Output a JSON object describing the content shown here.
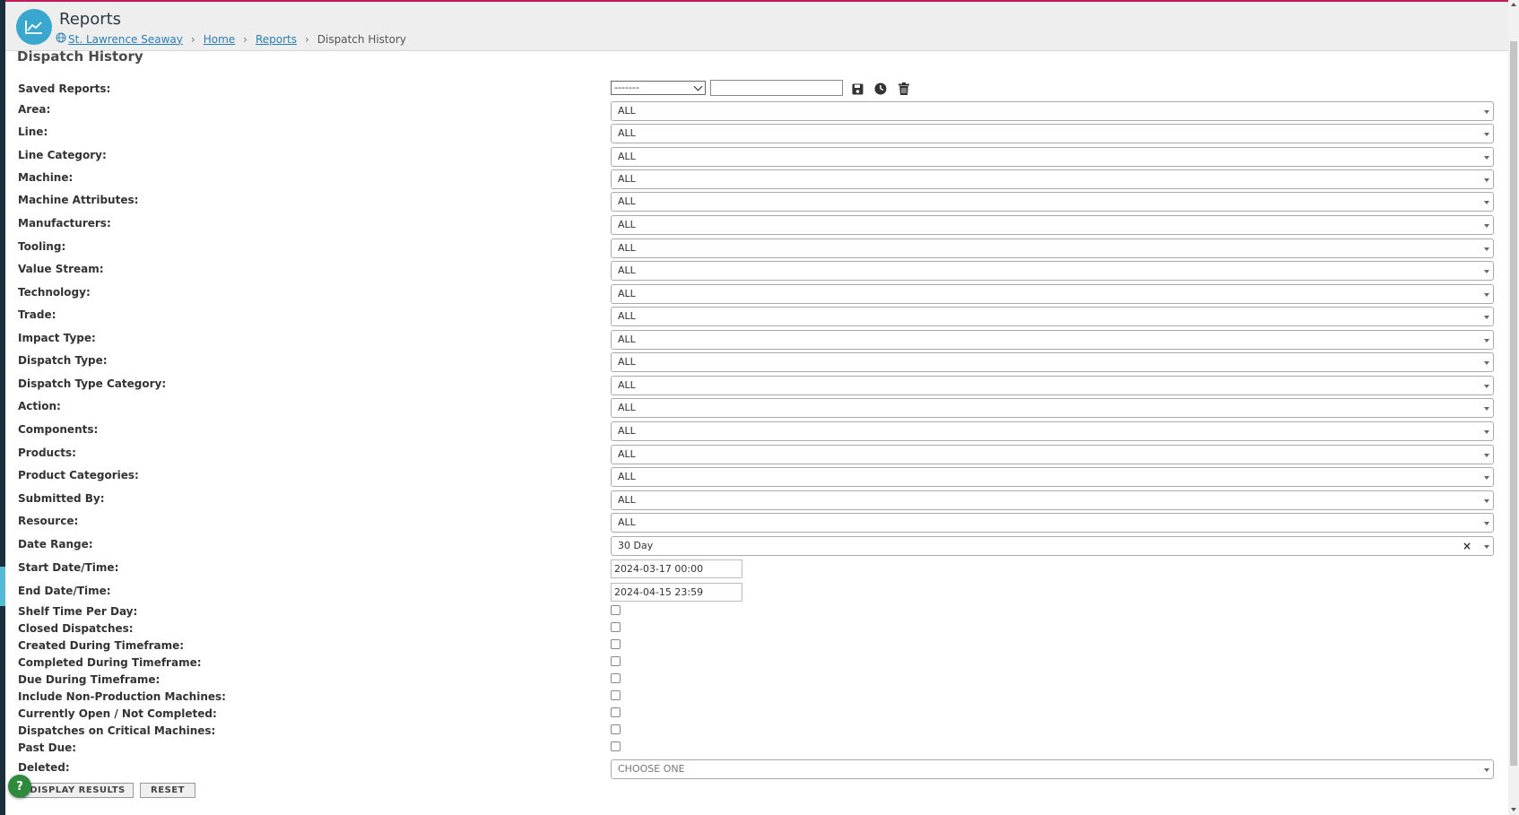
{
  "header": {
    "title": "Reports",
    "breadcrumb": {
      "site": "St. Lawrence Seaway",
      "home": "Home",
      "reports": "Reports",
      "current": "Dispatch History"
    }
  },
  "page": {
    "title": "Dispatch History"
  },
  "saved_reports": {
    "label": "Saved Reports:",
    "selected": "-------",
    "name_value": ""
  },
  "filters": [
    {
      "label": "Area:",
      "value": "ALL"
    },
    {
      "label": "Line:",
      "value": "ALL"
    },
    {
      "label": "Line Category:",
      "value": "ALL"
    },
    {
      "label": "Machine:",
      "value": "ALL"
    },
    {
      "label": "Machine Attributes:",
      "value": "ALL"
    },
    {
      "label": "Manufacturers:",
      "value": "ALL"
    },
    {
      "label": "Tooling:",
      "value": "ALL"
    },
    {
      "label": "Value Stream:",
      "value": "ALL"
    },
    {
      "label": "Technology:",
      "value": "ALL"
    },
    {
      "label": "Trade:",
      "value": "ALL"
    },
    {
      "label": "Impact Type:",
      "value": "ALL"
    },
    {
      "label": "Dispatch Type:",
      "value": "ALL"
    },
    {
      "label": "Dispatch Type Category:",
      "value": "ALL"
    },
    {
      "label": "Action:",
      "value": "ALL"
    },
    {
      "label": "Components:",
      "value": "ALL"
    },
    {
      "label": "Products:",
      "value": "ALL"
    },
    {
      "label": "Product Categories:",
      "value": "ALL"
    },
    {
      "label": "Submitted By:",
      "value": "ALL"
    },
    {
      "label": "Resource:",
      "value": "ALL"
    }
  ],
  "date_range": {
    "label": "Date Range:",
    "value": "30 Day",
    "clear": "×"
  },
  "start": {
    "label": "Start Date/Time:",
    "value": "2024-03-17 00:00"
  },
  "end": {
    "label": "End Date/Time:",
    "value": "2024-04-15 23:59"
  },
  "checkboxes": [
    {
      "label": "Shelf Time Per Day:",
      "checked": false
    },
    {
      "label": "Closed Dispatches:",
      "checked": false
    },
    {
      "label": "Created During Timeframe:",
      "checked": false
    },
    {
      "label": "Completed During Timeframe:",
      "checked": false
    },
    {
      "label": "Due During Timeframe:",
      "checked": false
    },
    {
      "label": "Include Non-Production Machines:",
      "checked": false
    },
    {
      "label": "Currently Open / Not Completed:",
      "checked": false
    },
    {
      "label": "Dispatches on Critical Machines:",
      "checked": false
    },
    {
      "label": "Past Due:",
      "checked": false
    }
  ],
  "deleted": {
    "label": "Deleted:",
    "placeholder": "CHOOSE ONE"
  },
  "buttons": {
    "display": "DISPLAY RESULTS",
    "reset": "RESET",
    "help": "?"
  },
  "colors": {
    "accent": "#3aa7cf",
    "link": "#2a7fb0",
    "help": "#2e8b3e",
    "top_bar": "#c2185b"
  }
}
